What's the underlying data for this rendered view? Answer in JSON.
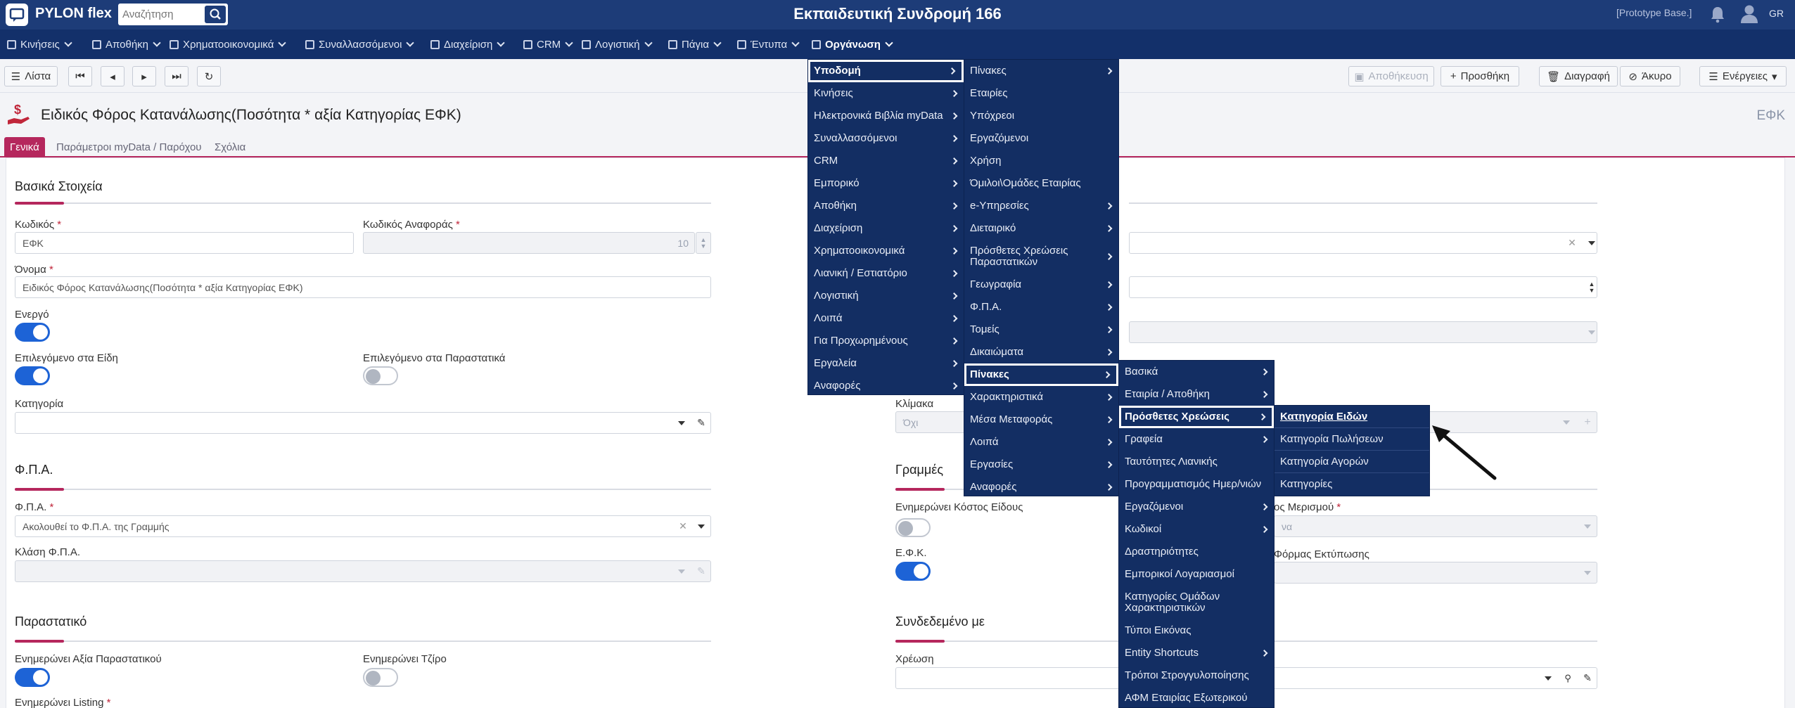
{
  "topbar": {
    "logo_text": "PYLON flex",
    "search_placeholder": "Αναζήτηση",
    "title": "Εκπαιδευτική Συνδρομή 166",
    "prototype": "[Prototype Base.]",
    "lang": "GR"
  },
  "menubar": {
    "items": [
      {
        "label": "Κινήσεις"
      },
      {
        "label": "Αποθήκη"
      },
      {
        "label": "Χρηματοοικονομικά"
      },
      {
        "label": "Συναλλασσόμενοι"
      },
      {
        "label": "Διαχείριση"
      },
      {
        "label": "CRM"
      },
      {
        "label": "Λογιστική"
      },
      {
        "label": "Πάγια"
      },
      {
        "label": "Έντυπα"
      },
      {
        "label": "Οργάνωση"
      }
    ]
  },
  "toolbar": {
    "list": "Λίστα",
    "save": "Αποθήκευση",
    "add": "Προσθήκη",
    "delete": "Διαγραφή",
    "cancel": "Άκυρο",
    "actions": "Ενέργειες"
  },
  "page": {
    "title": "Ειδικός Φόρος Κατανάλωσης(Ποσότητα * αξία Κατηγορίας ΕΦΚ)",
    "code": "ΕΦΚ"
  },
  "tabs": [
    "Γενικά",
    "Παράμετροι myData / Παρόχου",
    "Σχόλια"
  ],
  "form": {
    "basic_title": "Βασικά Στοιχεία",
    "code_label": "Κωδικός",
    "code_value": "ΕΦΚ",
    "ref_code_label": "Κωδικός Αναφοράς",
    "ref_code_value": "10",
    "name_label": "Όνομα",
    "name_value": "Ειδικός Φόρος Κατανάλωσης(Ποσότητα * αξία Κατηγορίας ΕΦΚ)",
    "active_label": "Ενεργό",
    "sel_items_label": "Επιλεγόμενο στα Είδη",
    "sel_docs_label": "Επιλεγόμενο στα Παραστατικά",
    "category_label": "Κατηγορία",
    "scale_label": "Κλίμακα",
    "scale_value": "Όχι",
    "vat_title": "Φ.Π.Α.",
    "vat_label": "Φ.Π.Α.",
    "vat_value": "Ακολουθεί το Φ.Π.Α. της Γραμμής",
    "vat_class_label": "Κλάση Φ.Π.Α.",
    "lines_title": "Γραμμές",
    "updates_cost_label": "Ενημερώνει Κόστος Είδους",
    "efk_label": "Ε.Φ.Κ.",
    "alloc_label_partial": "ος Μερισμού",
    "alloc_value_partial": "να",
    "print_label_partial": "Φόρμας Εκτύπωσης",
    "doc_title": "Παραστατικό",
    "updates_doc_value_label": "Ενημερώνει Αξία Παραστατικού",
    "updates_turnover_label": "Ενημερώνει Τζίρο",
    "updates_listing_label": "Ενημερώνει Listing",
    "linked_title": "Συνδεδεμένο με",
    "charge_label": "Χρέωση"
  },
  "menu1": [
    "Υποδομή",
    "Κινήσεις",
    "Ηλεκτρονικά Βιβλία myData",
    "Συναλλασσόμενοι",
    "CRM",
    "Εμπορικό",
    "Αποθήκη",
    "Διαχείριση",
    "Χρηματοοικονομικά",
    "Λιανική / Εστιατόριο",
    "Λογιστική",
    "Λοιπά",
    "Για Προχωρημένους",
    "Εργαλεία",
    "Αναφορές"
  ],
  "menu2": [
    "Πίνακες",
    "Εταιρίες",
    "Υπόχρεοι",
    "Εργαζόμενοι",
    "Χρήση",
    "Όμιλοι\\Ομάδες Εταιρίας",
    "e-Υπηρεσίες",
    "Διεταιρικό",
    "Πρόσθετες Χρεώσεις Παραστατικών",
    "Γεωγραφία",
    "Φ.Π.Α.",
    "Τομείς",
    "Δικαιώματα",
    "Πίνακες",
    "Χαρακτηριστικά",
    "Μέσα Μεταφοράς",
    "Λοιπά",
    "Εργασίες",
    "Αναφορές"
  ],
  "menu3": [
    "Βασικά",
    "Εταιρία / Αποθήκη",
    "Πρόσθετες Χρεώσεις",
    "Γραφεία",
    "Ταυτότητες Λιανικής",
    "Προγραμματισμός Ημερ/νιών",
    "Εργαζόμενοι",
    "Κωδικοί",
    "Δραστηριότητες",
    "Εμπορικοί Λογαριασμοί",
    "Κατηγορίες Ομάδων Χαρακτηριστικών",
    "Τύποι Εικόνας",
    "Entity Shortcuts",
    "Τρόποι Στρογγυλοποίησης",
    "ΑΦΜ Εταιρίας Εξωτερικού"
  ],
  "menu4": [
    "Κατηγορία Ειδών",
    "Κατηγορία Πωλήσεων",
    "Κατηγορία Αγορών",
    "Κατηγορίες"
  ],
  "colors": {
    "brand": "#1d3c78",
    "accent": "#b5275d",
    "toggle_on": "#1d63d6",
    "menu_bg": "#132e63"
  }
}
